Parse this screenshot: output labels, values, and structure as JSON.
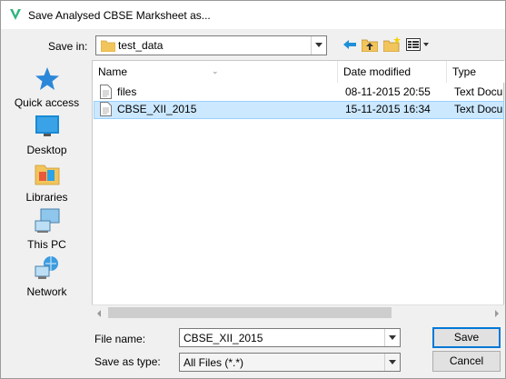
{
  "window": {
    "title": "Save Analysed CBSE Marksheet as..."
  },
  "toolbar": {
    "save_in_label": "Save in:",
    "save_in_value": "test_data"
  },
  "places": [
    {
      "label": "Quick access",
      "icon": "star-icon"
    },
    {
      "label": "Desktop",
      "icon": "desktop-icon"
    },
    {
      "label": "Libraries",
      "icon": "libraries-icon"
    },
    {
      "label": "This PC",
      "icon": "computer-icon"
    },
    {
      "label": "Network",
      "icon": "network-icon"
    }
  ],
  "file_list": {
    "columns": [
      "Name",
      "Date modified",
      "Type"
    ],
    "rows": [
      {
        "name": "files",
        "date": "08-11-2015 20:55",
        "type": "Text Docu"
      },
      {
        "name": "CBSE_XII_2015",
        "date": "15-11-2015 16:34",
        "type": "Text Docu",
        "selected": true
      }
    ]
  },
  "form": {
    "file_name_label": "File name:",
    "file_name_value": "CBSE_XII_2015",
    "save_type_label": "Save as type:",
    "save_type_value": "All Files (*.*)"
  },
  "buttons": {
    "save": "Save",
    "cancel": "Cancel"
  },
  "colors": {
    "accent": "#0078d7",
    "selection": "#cce8ff",
    "folder": "#f2c55c",
    "app_icon": "#2eb67d"
  }
}
